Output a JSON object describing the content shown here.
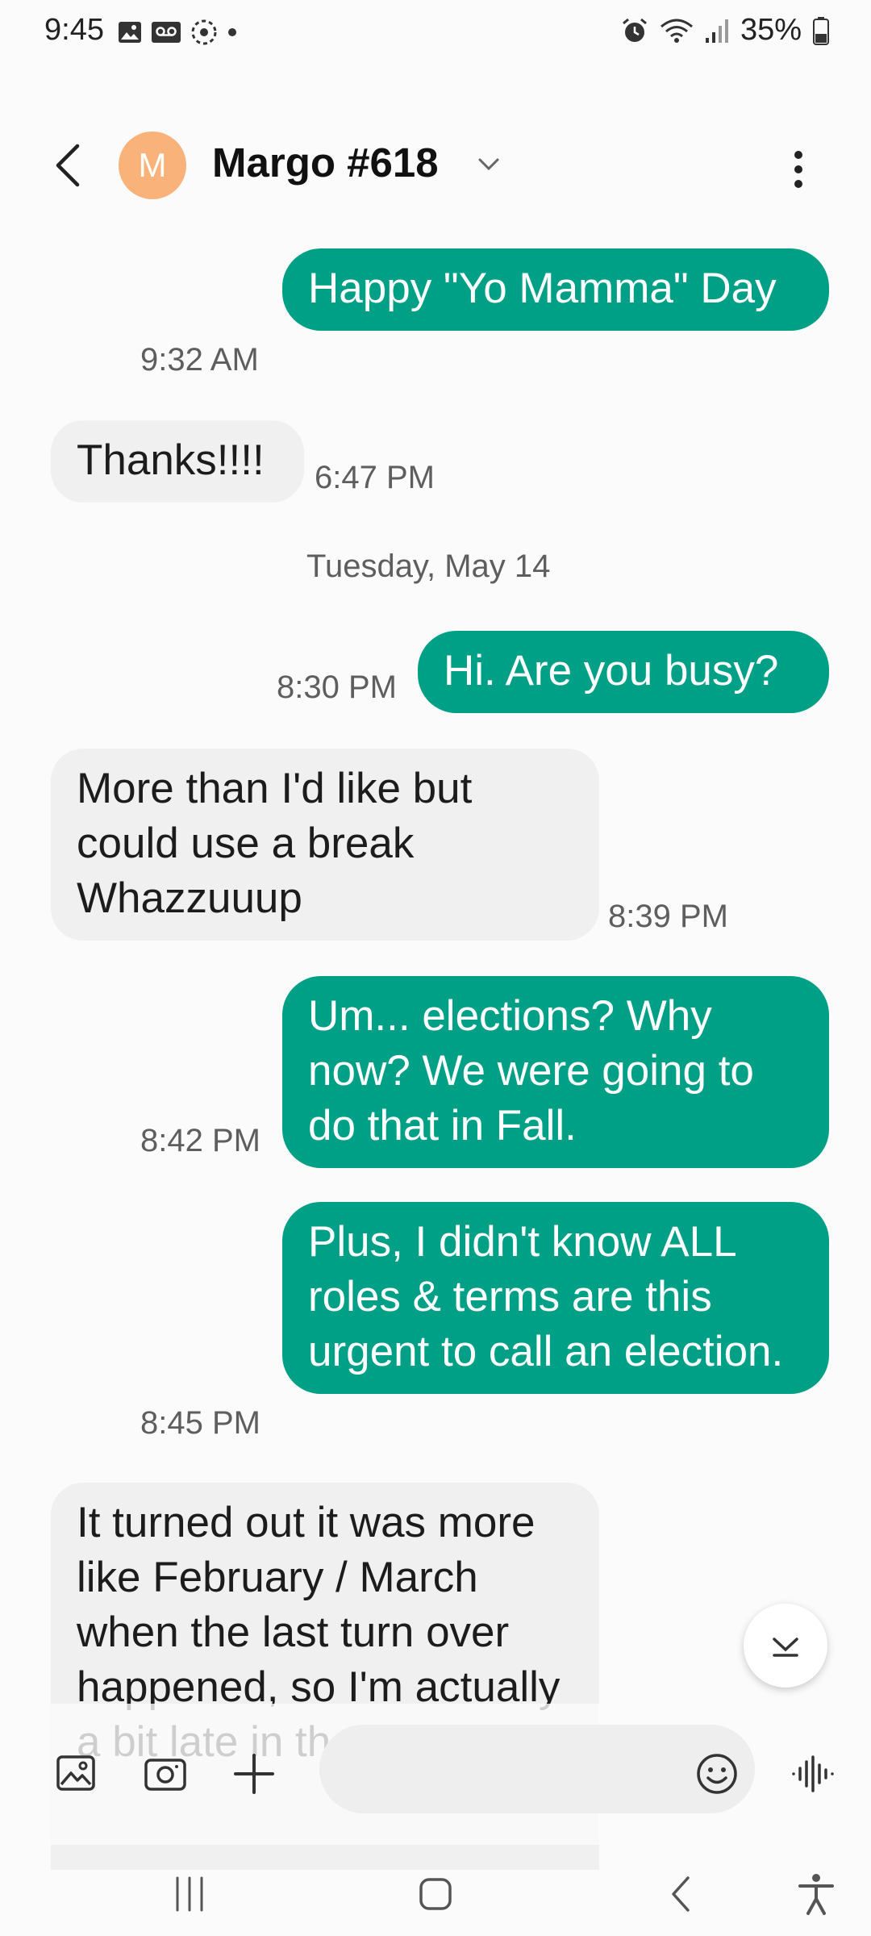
{
  "status_bar": {
    "time": "9:45",
    "battery": "35%",
    "icons": [
      "gallery-icon",
      "voicemail-icon",
      "sync-icon",
      "dot-icon",
      "alarm-icon",
      "wifi-icon",
      "signal-icon",
      "battery-icon"
    ]
  },
  "header": {
    "contact_name": "Margo #618",
    "avatar_initial": "M",
    "avatar_color": "#f9b37a"
  },
  "colors": {
    "outgoing_bubble": "#00a086",
    "incoming_bubble": "#f0f0f0"
  },
  "messages": [
    {
      "direction": "out",
      "text": "Happy \"Yo Mamma\" Day",
      "time": "9:32 AM"
    },
    {
      "direction": "in",
      "text": "Thanks!!!!",
      "time": "6:47 PM"
    },
    {
      "direction": "out",
      "text": "Hi. Are you busy?",
      "time": "8:30 PM"
    },
    {
      "direction": "in",
      "text": "More than I'd like but could use a break Whazzuuup",
      "time": "8:39 PM"
    },
    {
      "direction": "out",
      "text": "Um... elections? Why now? We were going to do that in Fall.",
      "time": "8:42 PM"
    },
    {
      "direction": "out",
      "text": "Plus, I didn't know ALL roles & terms are this urgent to call an election.",
      "time": "8:45 PM"
    },
    {
      "direction": "in",
      "text": "It turned out it was more like February / March when the last turn over happened, so I'm actually a bit late in the game.",
      "time": ""
    }
  ],
  "date_divider": "Tuesday, May 14",
  "compose": {
    "placeholder": "",
    "icons": [
      "gallery-icon",
      "camera-icon",
      "plus-icon",
      "emoji-icon",
      "voice-icon"
    ]
  },
  "nav_bar": {
    "icons": [
      "recent-apps-icon",
      "home-icon",
      "back-icon",
      "accessibility-icon"
    ]
  }
}
